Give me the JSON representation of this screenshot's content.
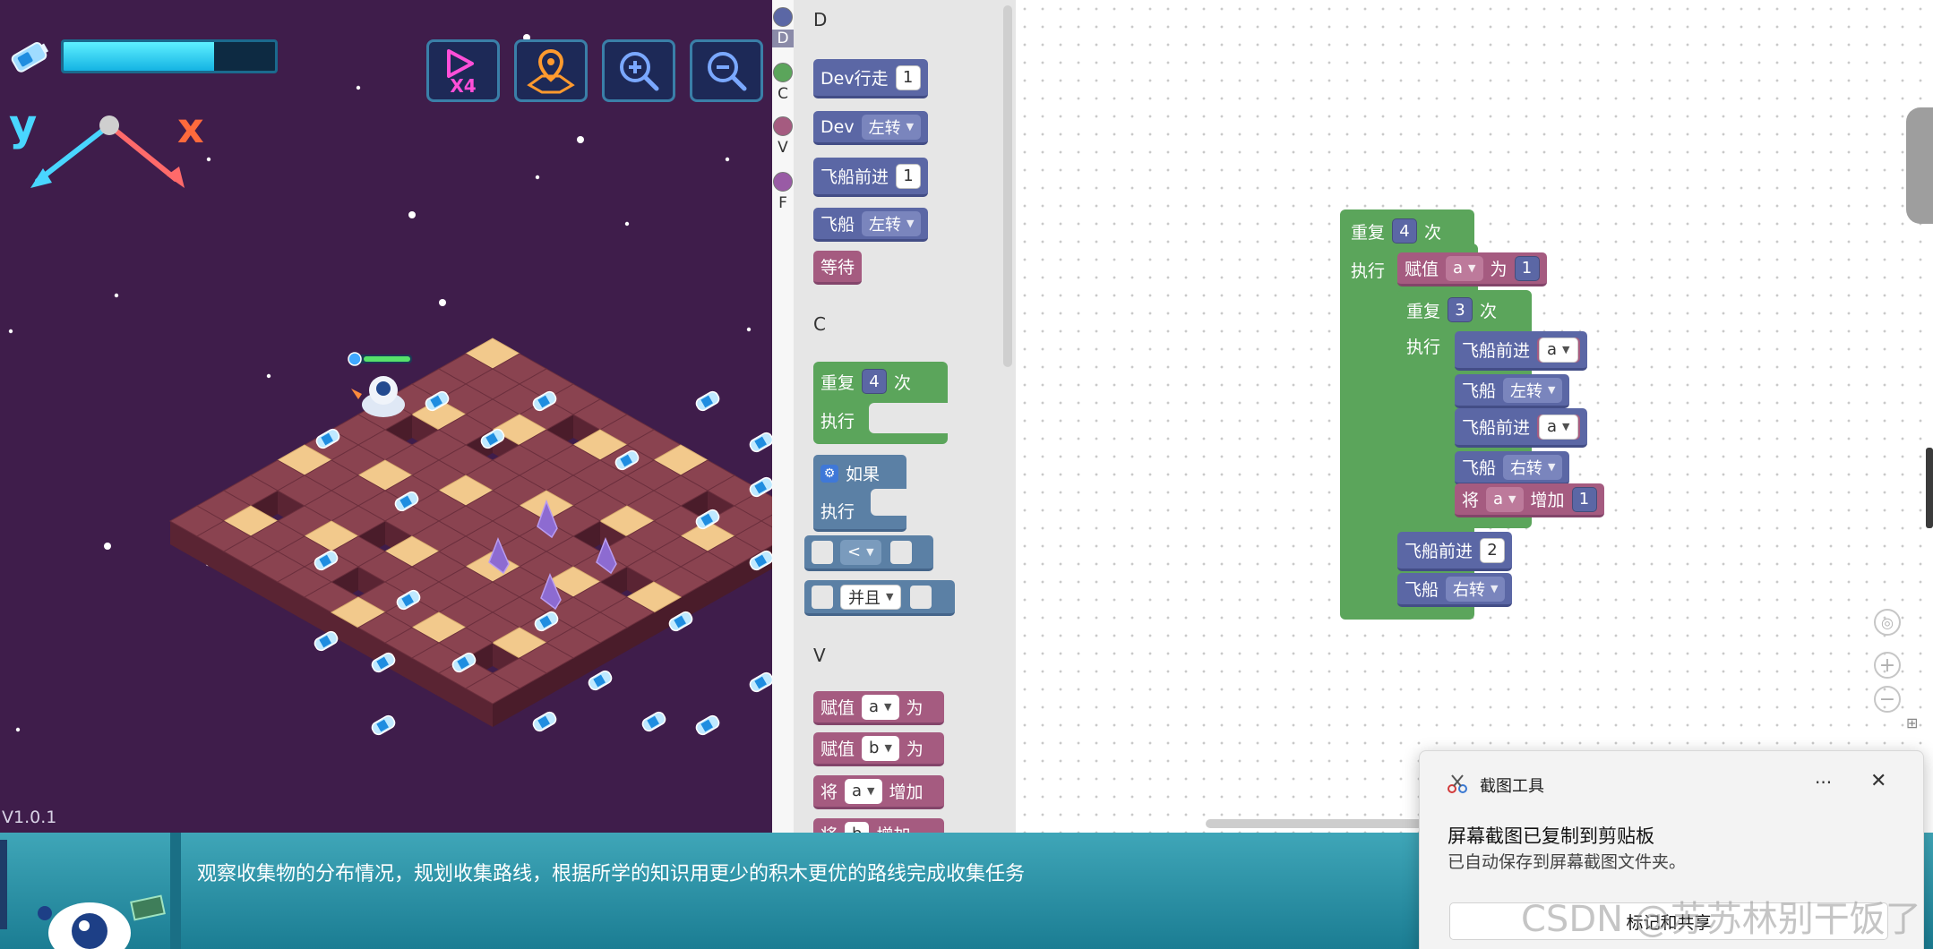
{
  "game": {
    "energy_level": 0.71,
    "axis_y": "y",
    "axis_x": "x",
    "version": "V1.0.1",
    "buttons": {
      "speed": "X4"
    },
    "player_health": 1.0
  },
  "toolbox": {
    "categories": [
      {
        "letter": "D",
        "color": "#5b67a5"
      },
      {
        "letter": "C",
        "color": "#5ba55b"
      },
      {
        "letter": "V",
        "color": "#a55b80"
      },
      {
        "letter": "F",
        "color": "#995ba5"
      }
    ],
    "sections": {
      "d": "D",
      "c": "C",
      "v": "V"
    },
    "blocks": {
      "dev_walk": {
        "label": "Dev行走",
        "value": "1"
      },
      "dev_turn": {
        "label": "Dev",
        "option": "左转"
      },
      "ship_forward": {
        "label": "飞船前进",
        "value": "1"
      },
      "ship_turn": {
        "label": "飞船",
        "option": "左转"
      },
      "wait": {
        "label": "等待"
      },
      "repeat": {
        "label": "重复",
        "value": "4",
        "suffix": "次",
        "do": "执行"
      },
      "if": {
        "label": "如果",
        "do": "执行"
      },
      "compare": {
        "option": "<"
      },
      "and": {
        "option": "并且"
      },
      "set_a": {
        "label": "赋值",
        "var": "a",
        "suffix": "为"
      },
      "set_b": {
        "label": "赋值",
        "var": "b",
        "suffix": "为"
      },
      "inc_a": {
        "label": "将",
        "var": "a",
        "suffix": "增加"
      },
      "inc_partial": {
        "label": "将",
        "var": "b",
        "suffix": "增加"
      }
    }
  },
  "workspace": {
    "outer_repeat": {
      "label": "重复",
      "value": "4",
      "suffix": "次",
      "do": "执行"
    },
    "set_a": {
      "label": "赋值",
      "var": "a",
      "suffix": "为",
      "value": "1"
    },
    "inner_repeat": {
      "label": "重复",
      "value": "3",
      "suffix": "次",
      "do": "执行"
    },
    "fwd1": {
      "label": "飞船前进",
      "var": "a"
    },
    "turn1": {
      "label": "飞船",
      "option": "左转"
    },
    "fwd2": {
      "label": "飞船前进",
      "var": "a"
    },
    "turn2": {
      "label": "飞船",
      "option": "右转"
    },
    "inc": {
      "label": "将",
      "var": "a",
      "suffix": "增加",
      "value": "1"
    },
    "fwd3": {
      "label": "飞船前进",
      "value": "2"
    },
    "turn3": {
      "label": "飞船",
      "option": "右转"
    }
  },
  "tip": {
    "text": "观察收集物的分布情况，规划收集路线，根据所学的知识用更少的积木更优的路线完成收集任务"
  },
  "toast": {
    "app_name": "截图工具",
    "more": "···",
    "close": "✕",
    "message": "屏幕截图已复制到剪贴板",
    "sub": "已自动保存到屏幕截图文件夹。",
    "button": "标记和共享"
  },
  "watermark": "CSDN @苏苏林别干饭了",
  "colors": {
    "stage_bg": "#3f1d4b",
    "motion_block": "#5b67a5",
    "loop_block": "#5ba55b",
    "variable_block": "#a55b80",
    "logic_block": "#5b80a5",
    "tip_bar": "#2a92a8"
  }
}
